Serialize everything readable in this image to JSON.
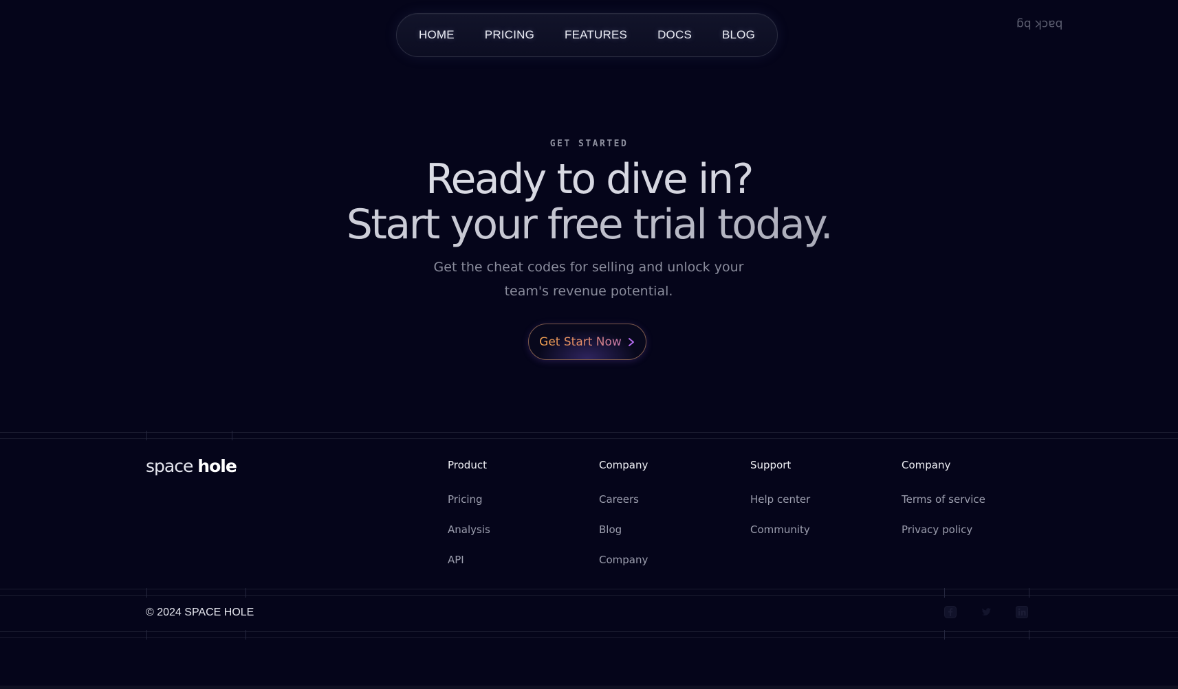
{
  "nav": {
    "items": [
      "HOME",
      "PRICING",
      "FEATURES",
      "DOCS",
      "BLOG"
    ]
  },
  "corner_label": "back bg",
  "hero": {
    "eyebrow": "GET STARTED",
    "title_line1": "Ready to dive in?",
    "title_line2": "Start your free trial today.",
    "subtitle": "Get the cheat codes for selling and unlock your team's revenue potential.",
    "cta_label": "Get Start Now",
    "cta_icon": "chevron-right-icon"
  },
  "footer": {
    "logo_light": "space",
    "logo_bold": "hole",
    "columns": [
      {
        "heading": "Product",
        "links": [
          "Pricing",
          "Analysis",
          "API"
        ]
      },
      {
        "heading": "Company",
        "links": [
          "Careers",
          "Blog",
          "Company"
        ]
      },
      {
        "heading": "Support",
        "links": [
          "Help center",
          "Community"
        ]
      },
      {
        "heading": "Company",
        "links": [
          "Terms of service",
          "Privacy policy"
        ]
      }
    ],
    "copyright": "© 2024 SPACE HOLE",
    "socials": [
      "facebook-icon",
      "twitter-icon",
      "linkedin-icon"
    ]
  },
  "colors": {
    "background": "#05051a",
    "cta_gradient_start": "#f0a050",
    "cta_gradient_end": "#c878b0",
    "chevron": "#b46cf0"
  }
}
